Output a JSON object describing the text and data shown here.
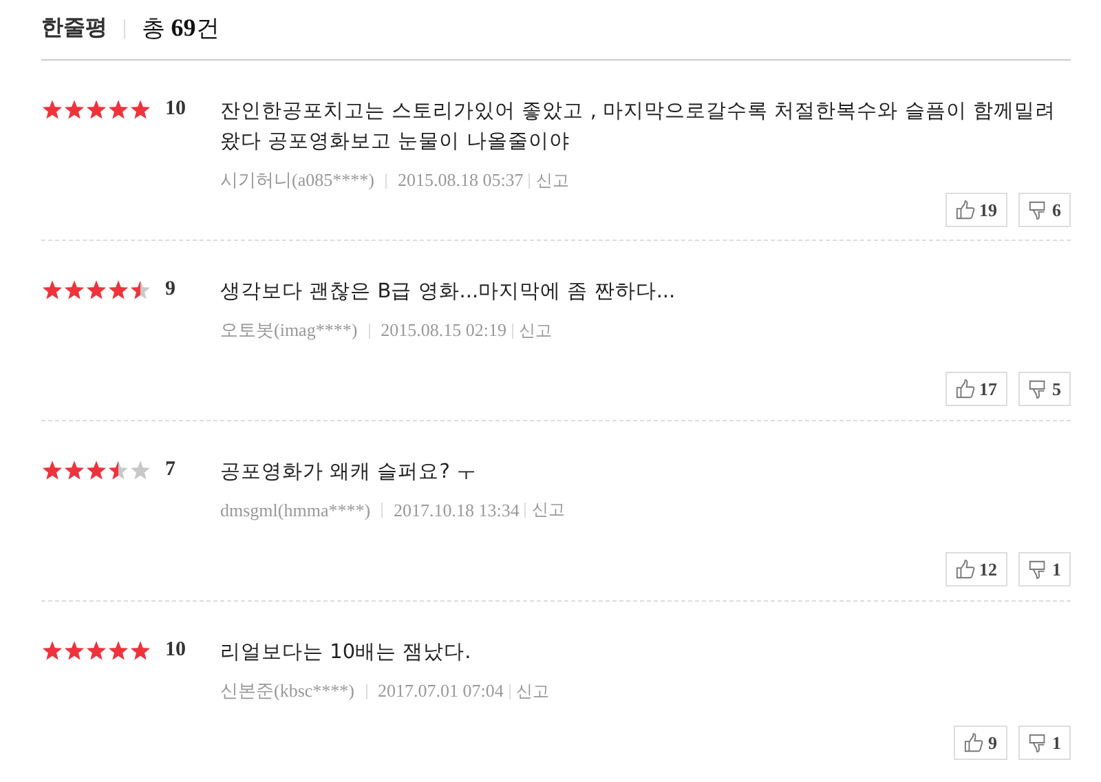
{
  "header": {
    "title": "한줄평",
    "total_label": "총",
    "total_count": "69",
    "total_unit": "건"
  },
  "reviews": [
    {
      "stars": 5,
      "score": "10",
      "text": "잔인한공포치고는 스토리가있어 좋았고 , 마지막으로갈수록 처절한복수와 슬픔이 함께밀려왔다 공포영화보고 눈물이 나올줄이야",
      "author": "시기허니(a085****)",
      "date": "2015.08.18 05:37",
      "report": "신고",
      "likes": "19",
      "dislikes": "6"
    },
    {
      "stars": 4.5,
      "score": "9",
      "text": "생각보다 괜찮은 B급 영화...마지막에 좀 짠하다...",
      "author": "오토봇(imag****)",
      "date": "2015.08.15 02:19",
      "report": "신고",
      "likes": "17",
      "dislikes": "5"
    },
    {
      "stars": 3.5,
      "score": "7",
      "text": "공포영화가 왜캐 슬퍼요? ㅜ",
      "author": "dmsgml(hmma****)",
      "date": "2017.10.18 13:34",
      "report": "신고",
      "likes": "12",
      "dislikes": "1"
    },
    {
      "stars": 5,
      "score": "10",
      "text": "리얼보다는 10배는 잼났다.",
      "author": "신본준(kbsc****)",
      "date": "2017.07.01 07:04",
      "report": "신고",
      "likes": "9",
      "dislikes": "1"
    }
  ]
}
